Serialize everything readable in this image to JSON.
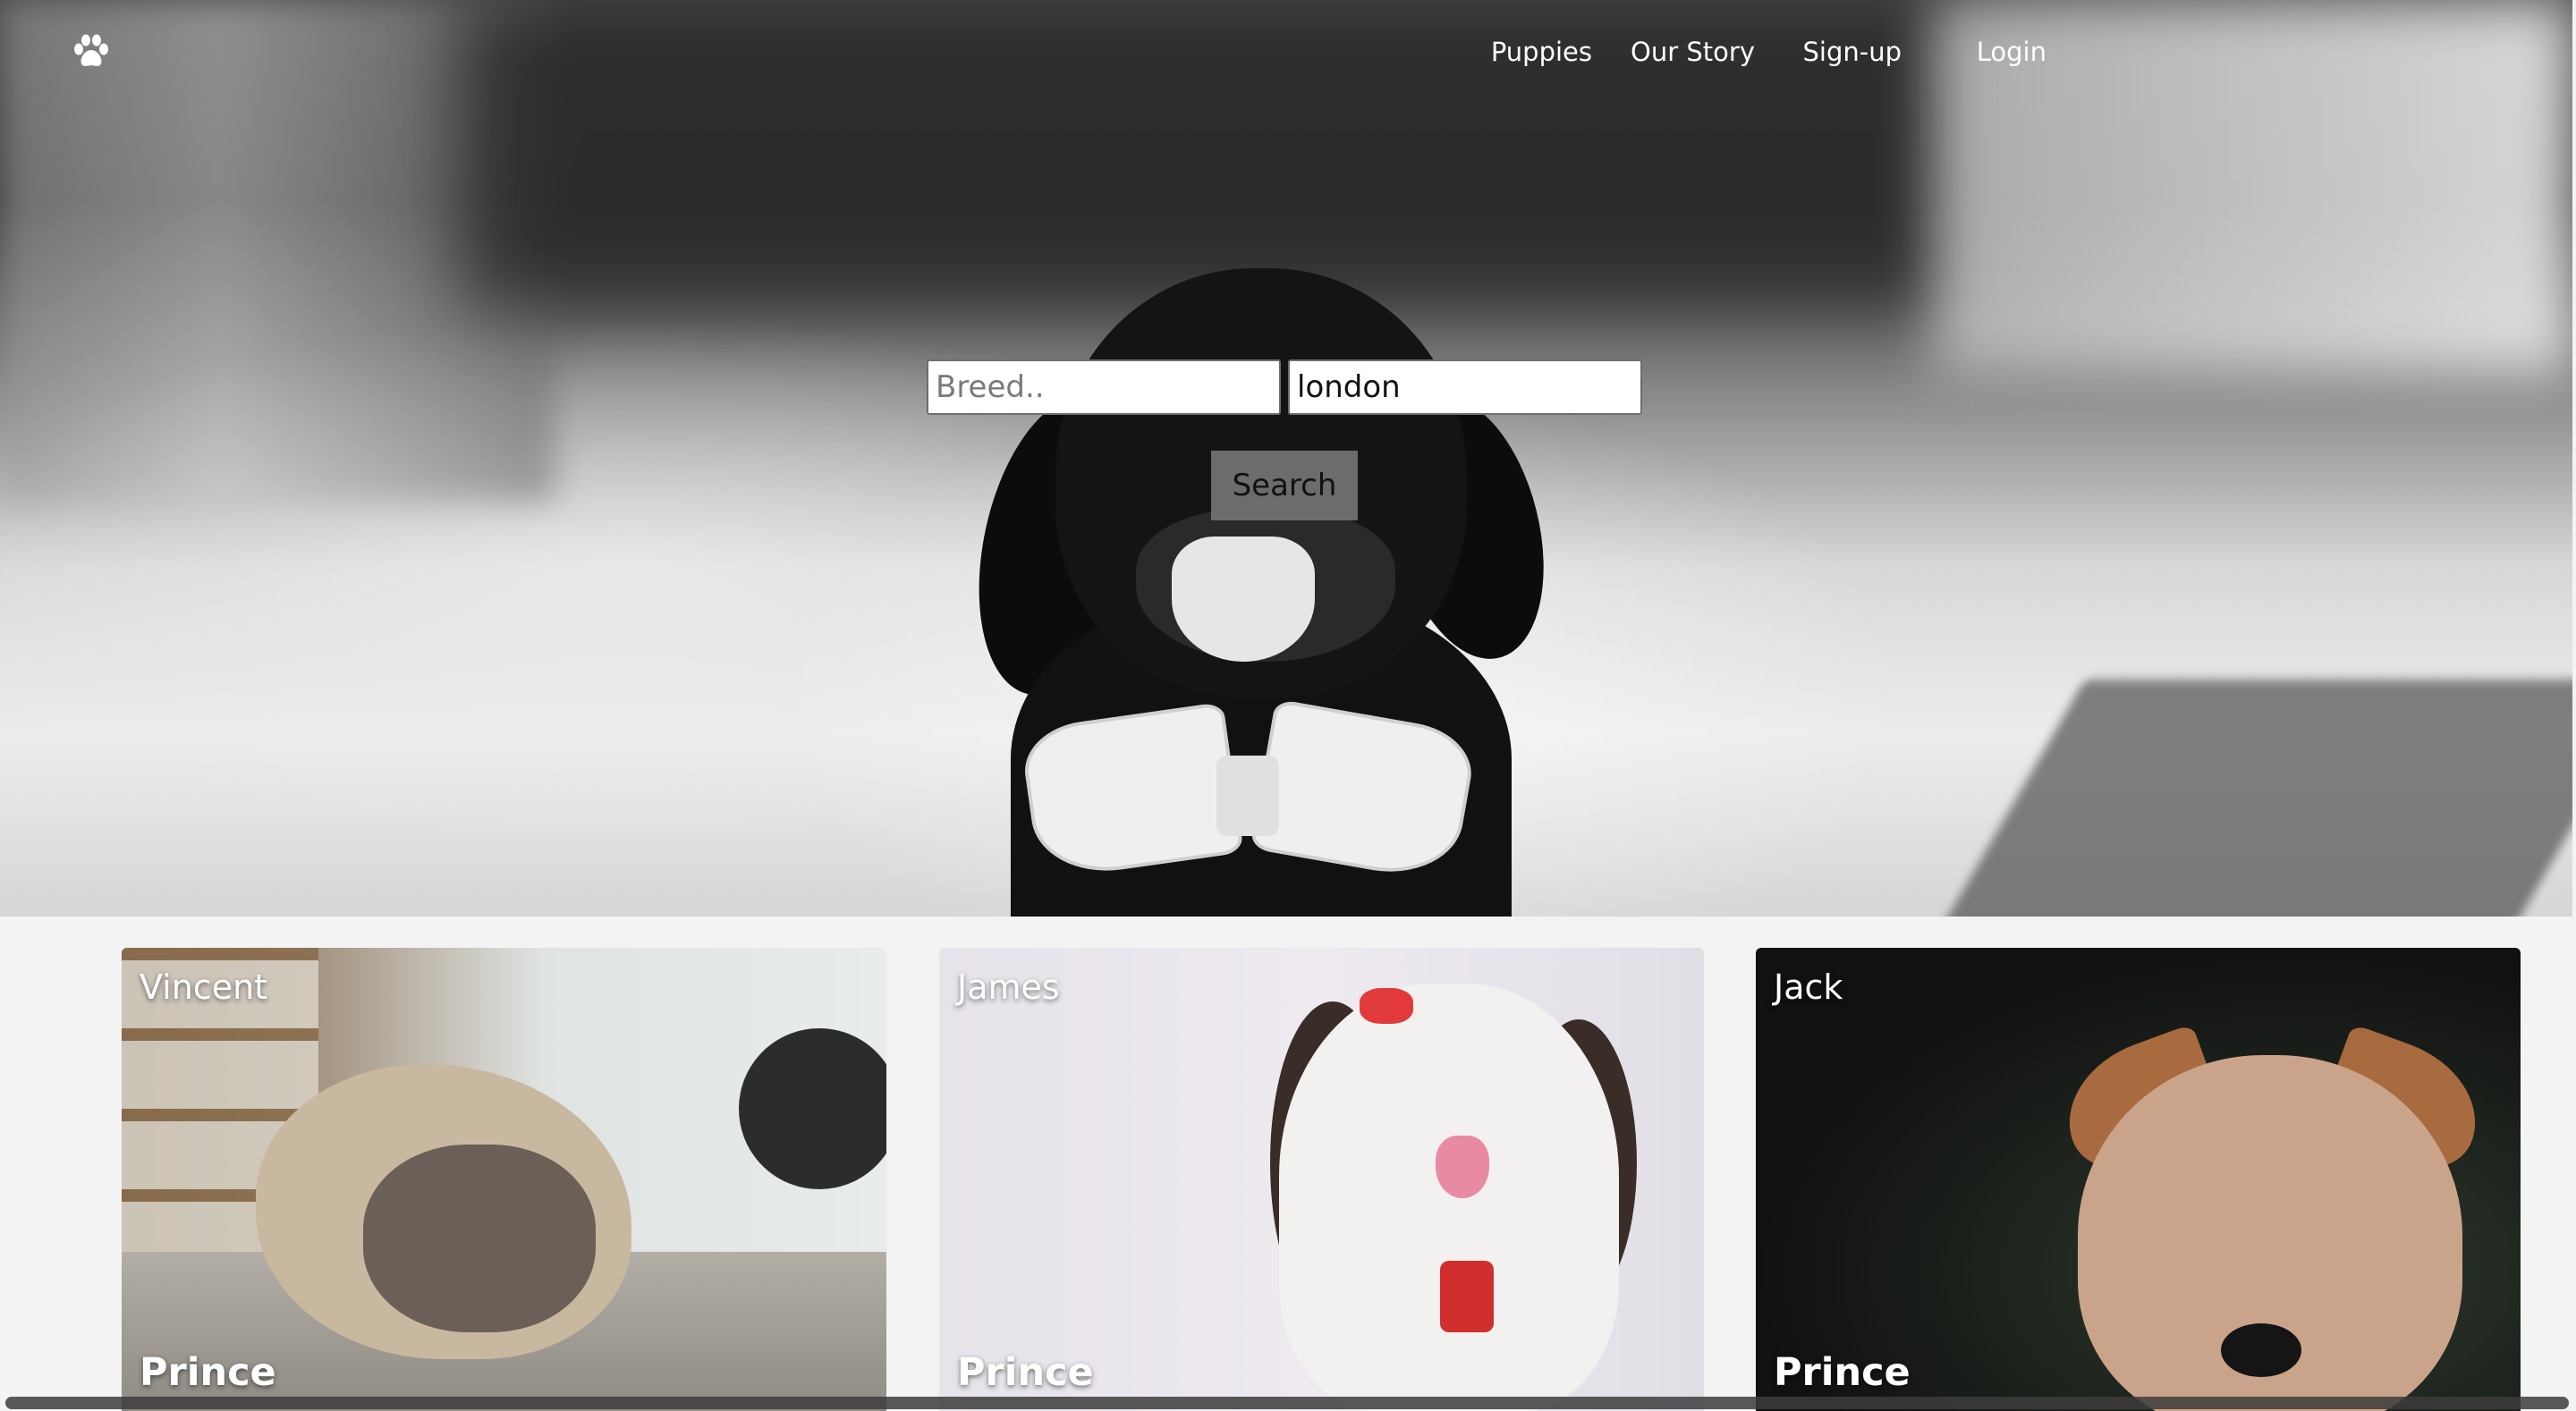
{
  "nav": {
    "logo_icon": "paw-icon",
    "items": [
      {
        "label": "Puppies"
      },
      {
        "label": "Our Story"
      },
      {
        "label": "Sign-up"
      },
      {
        "label": "Login"
      }
    ]
  },
  "search": {
    "breed_placeholder": "Breed..",
    "breed_value": "",
    "location_value": "london",
    "button_label": "Search"
  },
  "cards": [
    {
      "name": "Vincent",
      "tag": "Prince"
    },
    {
      "name": "James",
      "tag": "Prince"
    },
    {
      "name": "Jack",
      "tag": "Prince"
    }
  ]
}
